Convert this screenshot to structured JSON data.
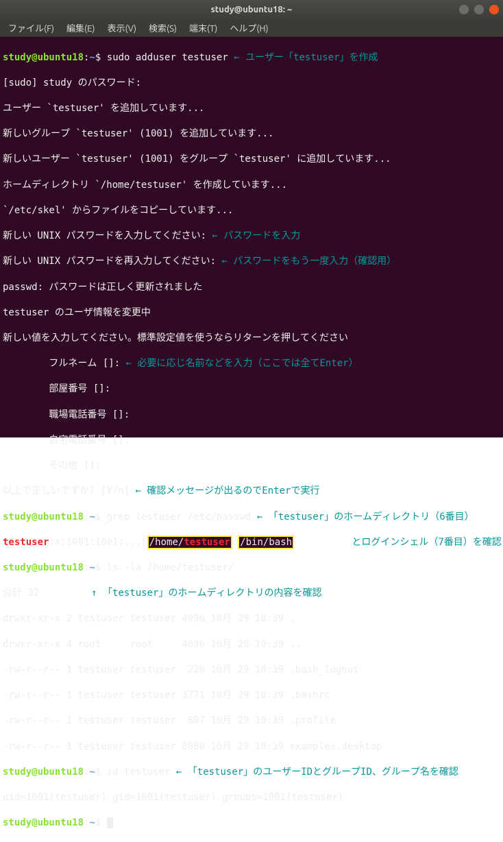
{
  "window": {
    "title": "study@ubuntu18: ~"
  },
  "menubar": {
    "items": [
      "ファイル(F)",
      "編集(E)",
      "表示(V)",
      "検索(S)",
      "端末(T)",
      "ヘルプ(H)"
    ]
  },
  "prompt": {
    "user_host": "study@ubuntu18",
    "colon": ":",
    "path": "~",
    "dollar": "$"
  },
  "session": {
    "cmd1": "sudo adduser testuser",
    "cmd1_annot": " ← ユーザー「testuser」を作成",
    "out1": [
      "[sudo] study のパスワード:",
      "ユーザー `testuser' を追加しています...",
      "新しいグループ `testuser' (1001) を追加しています...",
      "新しいユーザー `testuser' (1001) をグループ `testuser' に追加しています...",
      "ホームディレクトリ `/home/testuser' を作成しています...",
      "`/etc/skel' からファイルをコピーしています..."
    ],
    "pw_line1": "新しい UNIX パスワードを入力してください:",
    "pw_line1_annot": " ← パスワードを入力",
    "pw_line2": "新しい UNIX パスワードを再入力してください:",
    "pw_line2_annot": " ← パスワードをもう一度入力（確認用）",
    "out2": [
      "passwd: パスワードは正しく更新されました",
      "testuser のユーザ情報を変更中",
      "新しい値を入力してください。標準設定値を使うならリターンを押してください"
    ],
    "field_fullname": "        フルネーム []:",
    "field_fullname_annot": " ← 必要に応じ名前などを入力（ここでは全てEnter）",
    "fields_rest": [
      "        部屋番号 []:",
      "        職場電話番号 []:",
      "        自宅電話番号 []:",
      "        その他 []:"
    ],
    "confirm_line": "以上で正しいですか? [Y/n]",
    "confirm_annot": " ← 確認メッセージが出るのでEnterで実行",
    "cmd2": "grep testuser /etc/passwd",
    "cmd2_annot": " ← 「testuser」のホームディレクトリ（6番目）",
    "cmd2_annot2": "          とログインシェル（7番目）を確認",
    "grep_out": {
      "prefix": "testuser",
      "mid": ":x:1001:1001:,,,:",
      "home_pre": "/home/",
      "home_user": "testuser",
      "sep": ":",
      "shell": "/bin/bash"
    },
    "cmd3": "ls -la /home/testuser/",
    "ls_total": "合計 32",
    "ls_total_annot": "         ↑ 「testuser」のホームディレクトリの内容を確認",
    "ls_lines": [
      "drwxr-xr-x 2 testuser testuser 4096 10月 29 10:39 .",
      "drwxr-xr-x 4 root     root     4096 10月 29 10:39 ..",
      "-rw-r--r-- 1 testuser testuser  220 10月 29 10:39 .bash_logout",
      "-rw-r--r-- 1 testuser testuser 3771 10月 29 10:39 .bashrc",
      "-rw-r--r-- 1 testuser testuser  807 10月 29 10:39 .profile",
      "-rw-r--r-- 1 testuser testuser 8980 10月 29 10:39 examples.desktop"
    ],
    "cmd4": "id testuser",
    "cmd4_annot": " ← 「testuser」のユーザーIDとグループID、グループ名を確認",
    "id_out": "uid=1001(testuser) gid=1001(testuser) groups=1001(testuser)"
  }
}
